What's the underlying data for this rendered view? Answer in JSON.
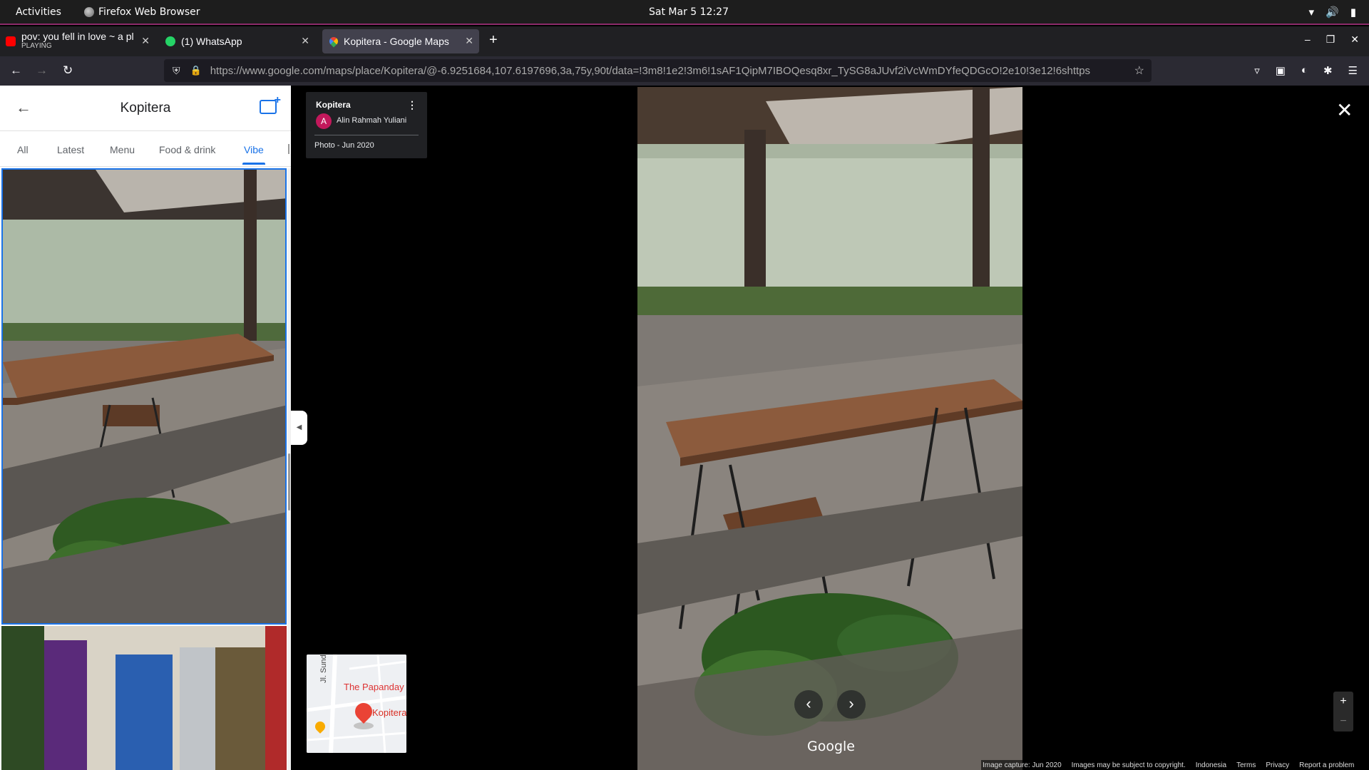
{
  "topbar": {
    "activities": "Activities",
    "app_name": "Firefox Web Browser",
    "datetime": "Sat Mar 5  12:27"
  },
  "browser": {
    "tabs": [
      {
        "label": "pov: you fell in love ~ a pl",
        "sublabel": "PLAYING",
        "icon": "youtube-icon"
      },
      {
        "label": "(1) WhatsApp",
        "icon": "whatsapp-icon"
      },
      {
        "label": "Kopitera - Google Maps",
        "icon": "google-maps-icon",
        "active": true
      }
    ],
    "url": "https://www.google.com/maps/place/Kopitera/@-6.9251684,107.6197696,3a,75y,90t/data=!3m8!1e2!3m6!1sAF1QipM7IBOQesq8xr_TySG8aJUvf2iVcWmDYfeQDGcO!2e10!3e12!6shttps"
  },
  "sidepanel": {
    "title": "Kopitera",
    "tabs": [
      "All",
      "Latest",
      "Menu",
      "Food & drink",
      "Vibe"
    ],
    "active_tab": "Vibe"
  },
  "photo_info": {
    "place": "Kopitera",
    "author_initial": "A",
    "author": "Alin Rahmah Yuliani",
    "date": "Photo - Jun 2020"
  },
  "minimap": {
    "street": "Jl. Sunda",
    "poi": "The Papanday",
    "place": "Kopitera"
  },
  "viewer": {
    "logo": "Google",
    "zoom_in": "+",
    "zoom_out": "−",
    "footer": [
      "Image capture: Jun 2020",
      "Images may be subject to copyright.",
      "Indonesia",
      "Terms",
      "Privacy",
      "Report a problem"
    ]
  },
  "colors": {
    "accent": "#1a73e8",
    "topbar_border": "#8c2a6a",
    "pin": "#ea4335"
  }
}
